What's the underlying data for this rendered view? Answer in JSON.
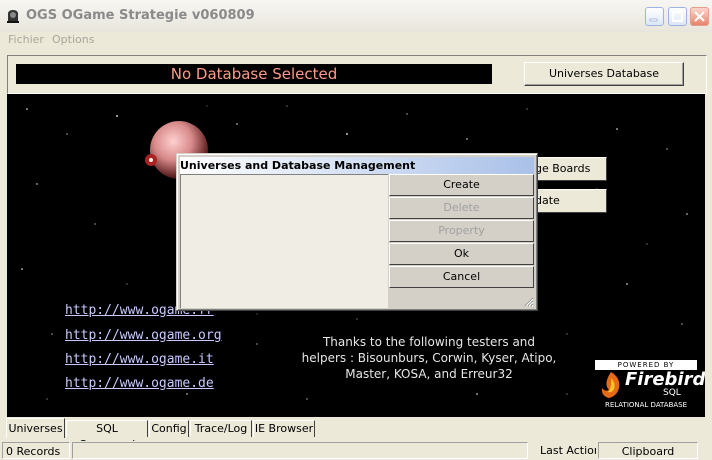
{
  "window": {
    "title": "OGS OGame Strategie  v060809"
  },
  "menu": {
    "items": [
      "Fichier",
      "Options"
    ]
  },
  "top": {
    "db_status": "No Database Selected",
    "universes_button": "Universes Database"
  },
  "side_buttons": {
    "message_boards": "ge Boards",
    "update": "date"
  },
  "dialog": {
    "title": "Universes and Database Management",
    "buttons": {
      "create": "Create",
      "delete": "Delete",
      "property": "Property",
      "ok": "Ok",
      "cancel": "Cancel"
    }
  },
  "links": [
    "http://www.ogame.fr",
    "http://www.ogame.org",
    "http://www.ogame.it",
    "http://www.ogame.de"
  ],
  "thanks": {
    "line1": "Thanks to the following testers and",
    "line2": "helpers  :  Bisounburs, Corwin, Kyser, Atipo,",
    "line3": "Master, KOSA, and Erreur32"
  },
  "firebird": {
    "powered": "POWERED BY",
    "name": "Firebird",
    "sql": "SQL",
    "tagline": "RELATIONAL DATABASE"
  },
  "tabs": [
    "Universes",
    "SQL Command",
    "Config",
    "Trace/Log",
    "IE Browser"
  ],
  "status": {
    "records": "0 Records",
    "last_action": "Last Action",
    "clipboard": "Clipboard"
  },
  "colors": {
    "db_status_text": "#ff9a88",
    "link": "#c9c9ff"
  }
}
